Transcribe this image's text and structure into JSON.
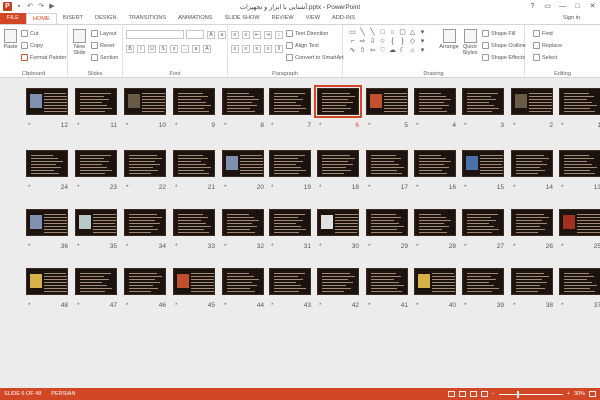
{
  "window": {
    "title": "آشنایی با ابزار و تجهیزات.pptx - PowerPoint",
    "controls": {
      "help": "?",
      "restore": "▭",
      "minimize": "—",
      "maximize": "□",
      "close": "✕"
    },
    "sign_in": "Sign in"
  },
  "qat": {
    "undo": "↶",
    "redo": "↷",
    "start": "▶"
  },
  "tabs": [
    "FILE",
    "HOME",
    "INSERT",
    "DESIGN",
    "TRANSITIONS",
    "ANIMATIONS",
    "SLIDE SHOW",
    "REVIEW",
    "VIEW",
    "ADD-INS"
  ],
  "active_tab": "HOME",
  "ribbon": {
    "clipboard": {
      "label": "Clipboard",
      "paste": "Paste",
      "cut": "Cut",
      "copy": "Copy",
      "format_painter": "Format Painter"
    },
    "slides": {
      "label": "Slides",
      "new_slide": "New Slide",
      "layout": "Layout",
      "reset": "Reset",
      "section": "Section"
    },
    "font": {
      "label": "Font"
    },
    "paragraph": {
      "label": "Paragraph",
      "text_direction": "Text Direction",
      "align_text": "Align Text",
      "convert_smartart": "Convert to SmartArt"
    },
    "drawing": {
      "label": "Drawing",
      "arrange": "Arrange",
      "quick_styles": "Quick Styles",
      "shape_fill": "Shape Fill",
      "shape_outline": "Shape Outline",
      "shape_effects": "Shape Effects"
    },
    "editing": {
      "label": "Editing",
      "find": "Find",
      "replace": "Replace",
      "select": "Select"
    }
  },
  "slides": {
    "star": "*",
    "selected": 6,
    "rows": [
      [
        12,
        11,
        10,
        9,
        8,
        7,
        6,
        5,
        4,
        3,
        2,
        1
      ],
      [
        24,
        23,
        22,
        21,
        20,
        19,
        18,
        17,
        16,
        15,
        14,
        13
      ],
      [
        36,
        35,
        34,
        33,
        32,
        31,
        30,
        29,
        28,
        27,
        26,
        25
      ],
      [
        48,
        47,
        46,
        45,
        44,
        43,
        42,
        41,
        40,
        39,
        38,
        37
      ]
    ]
  },
  "status": {
    "slide_info": "SLIDE 6 OF 48",
    "language": "PERSIAN",
    "zoom": "30%"
  },
  "colors": {
    "accent": "#d24726",
    "slide_bg": "#1c130e"
  }
}
